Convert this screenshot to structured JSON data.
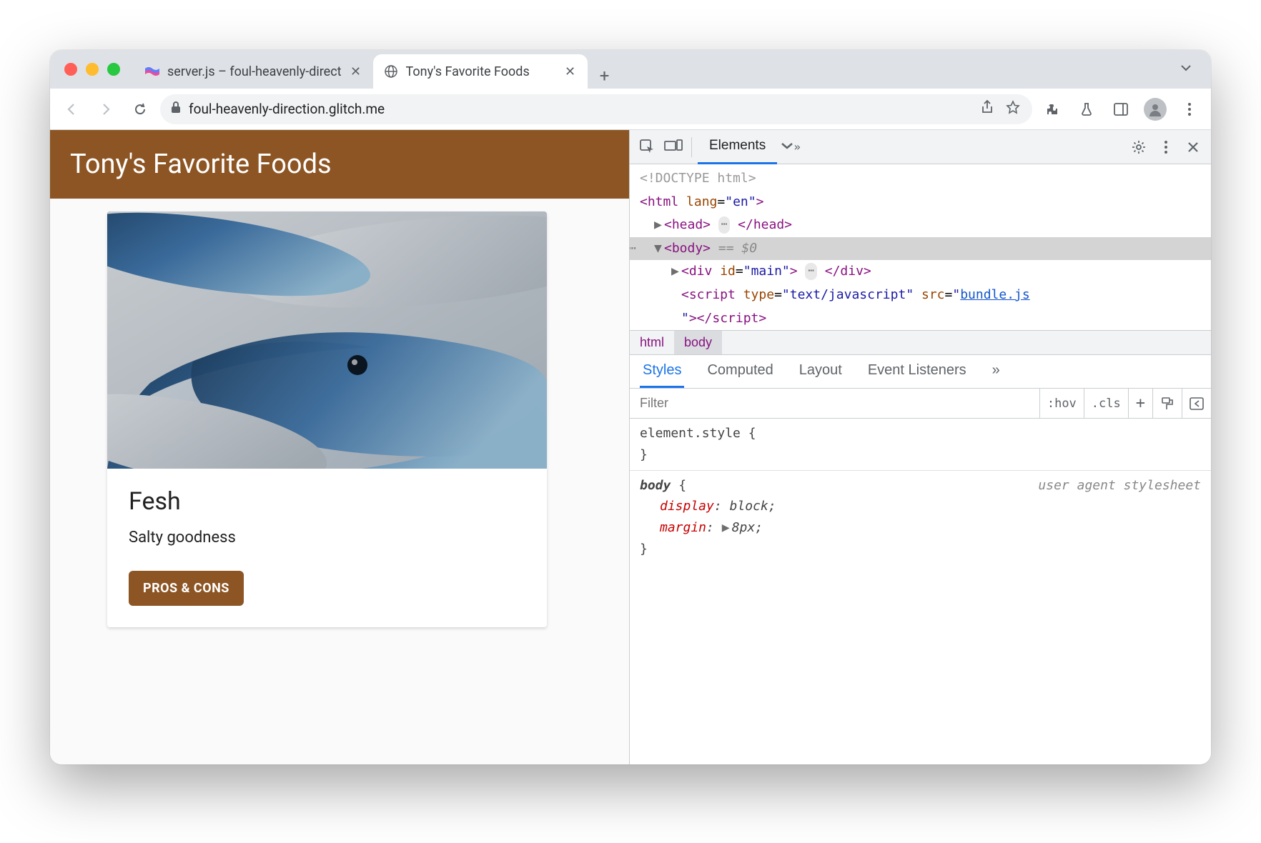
{
  "browser": {
    "tabs": [
      {
        "title": "server.js – foul-heavenly-direct",
        "active": false
      },
      {
        "title": "Tony's Favorite Foods",
        "active": true
      }
    ],
    "url": "foul-heavenly-direction.glitch.me"
  },
  "page": {
    "banner": "Tony's Favorite Foods",
    "card": {
      "title": "Fesh",
      "subtitle": "Salty goodness",
      "button": "PROS & CONS"
    }
  },
  "devtools": {
    "panels": {
      "active": "Elements"
    },
    "elements": {
      "doctype": "<!DOCTYPE html>",
      "html_attr": {
        "lang": "en"
      },
      "body_sel": "== $0",
      "div_id": "main",
      "script_type": "text/javascript",
      "script_src": "bundle.js"
    },
    "crumbs": [
      "html",
      "body"
    ],
    "styles": {
      "tabs": [
        "Styles",
        "Computed",
        "Layout",
        "Event Listeners"
      ],
      "filter_placeholder": "Filter",
      "hov": ":hov",
      "cls": ".cls",
      "rule1_sel": "element.style",
      "rule2_sel": "body",
      "rule2_src": "user agent stylesheet",
      "props": [
        {
          "name": "display",
          "value": "block"
        },
        {
          "name": "margin",
          "value": "8px",
          "expandable": true
        }
      ]
    }
  }
}
